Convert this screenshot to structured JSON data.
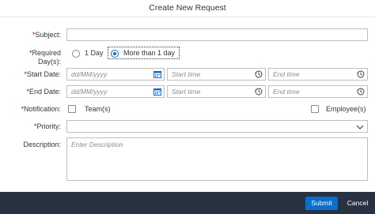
{
  "dialog": {
    "title": "Create New Request"
  },
  "form": {
    "subject": {
      "label": "Subject:",
      "value": ""
    },
    "required_days": {
      "label_line1": "Required",
      "label_line2": "Day(s):",
      "options": [
        "1 Day",
        "More than 1 day"
      ],
      "selected": "More than 1 day"
    },
    "start_date": {
      "label": "Start Date:",
      "date_placeholder": "dd/MM/yyyy",
      "start_time_placeholder": "Start time",
      "end_time_placeholder": "End time"
    },
    "end_date": {
      "label": "End Date:",
      "date_placeholder": "dd/MM/yyyy",
      "start_time_placeholder": "Start time",
      "end_time_placeholder": "End time"
    },
    "notification": {
      "label": "Notification:",
      "option_team": "Team(s)",
      "option_employee": "Employee(s)"
    },
    "priority": {
      "label": "Priority:",
      "value": ""
    },
    "description": {
      "label": "Description:",
      "placeholder": "Enter Description"
    },
    "required_marker": "*"
  },
  "footer": {
    "submit_label": "Submit",
    "cancel_label": "Cancel"
  },
  "colors": {
    "accent": "#0a6ed1",
    "footer_bg": "#293240",
    "required": "#bb0000"
  }
}
